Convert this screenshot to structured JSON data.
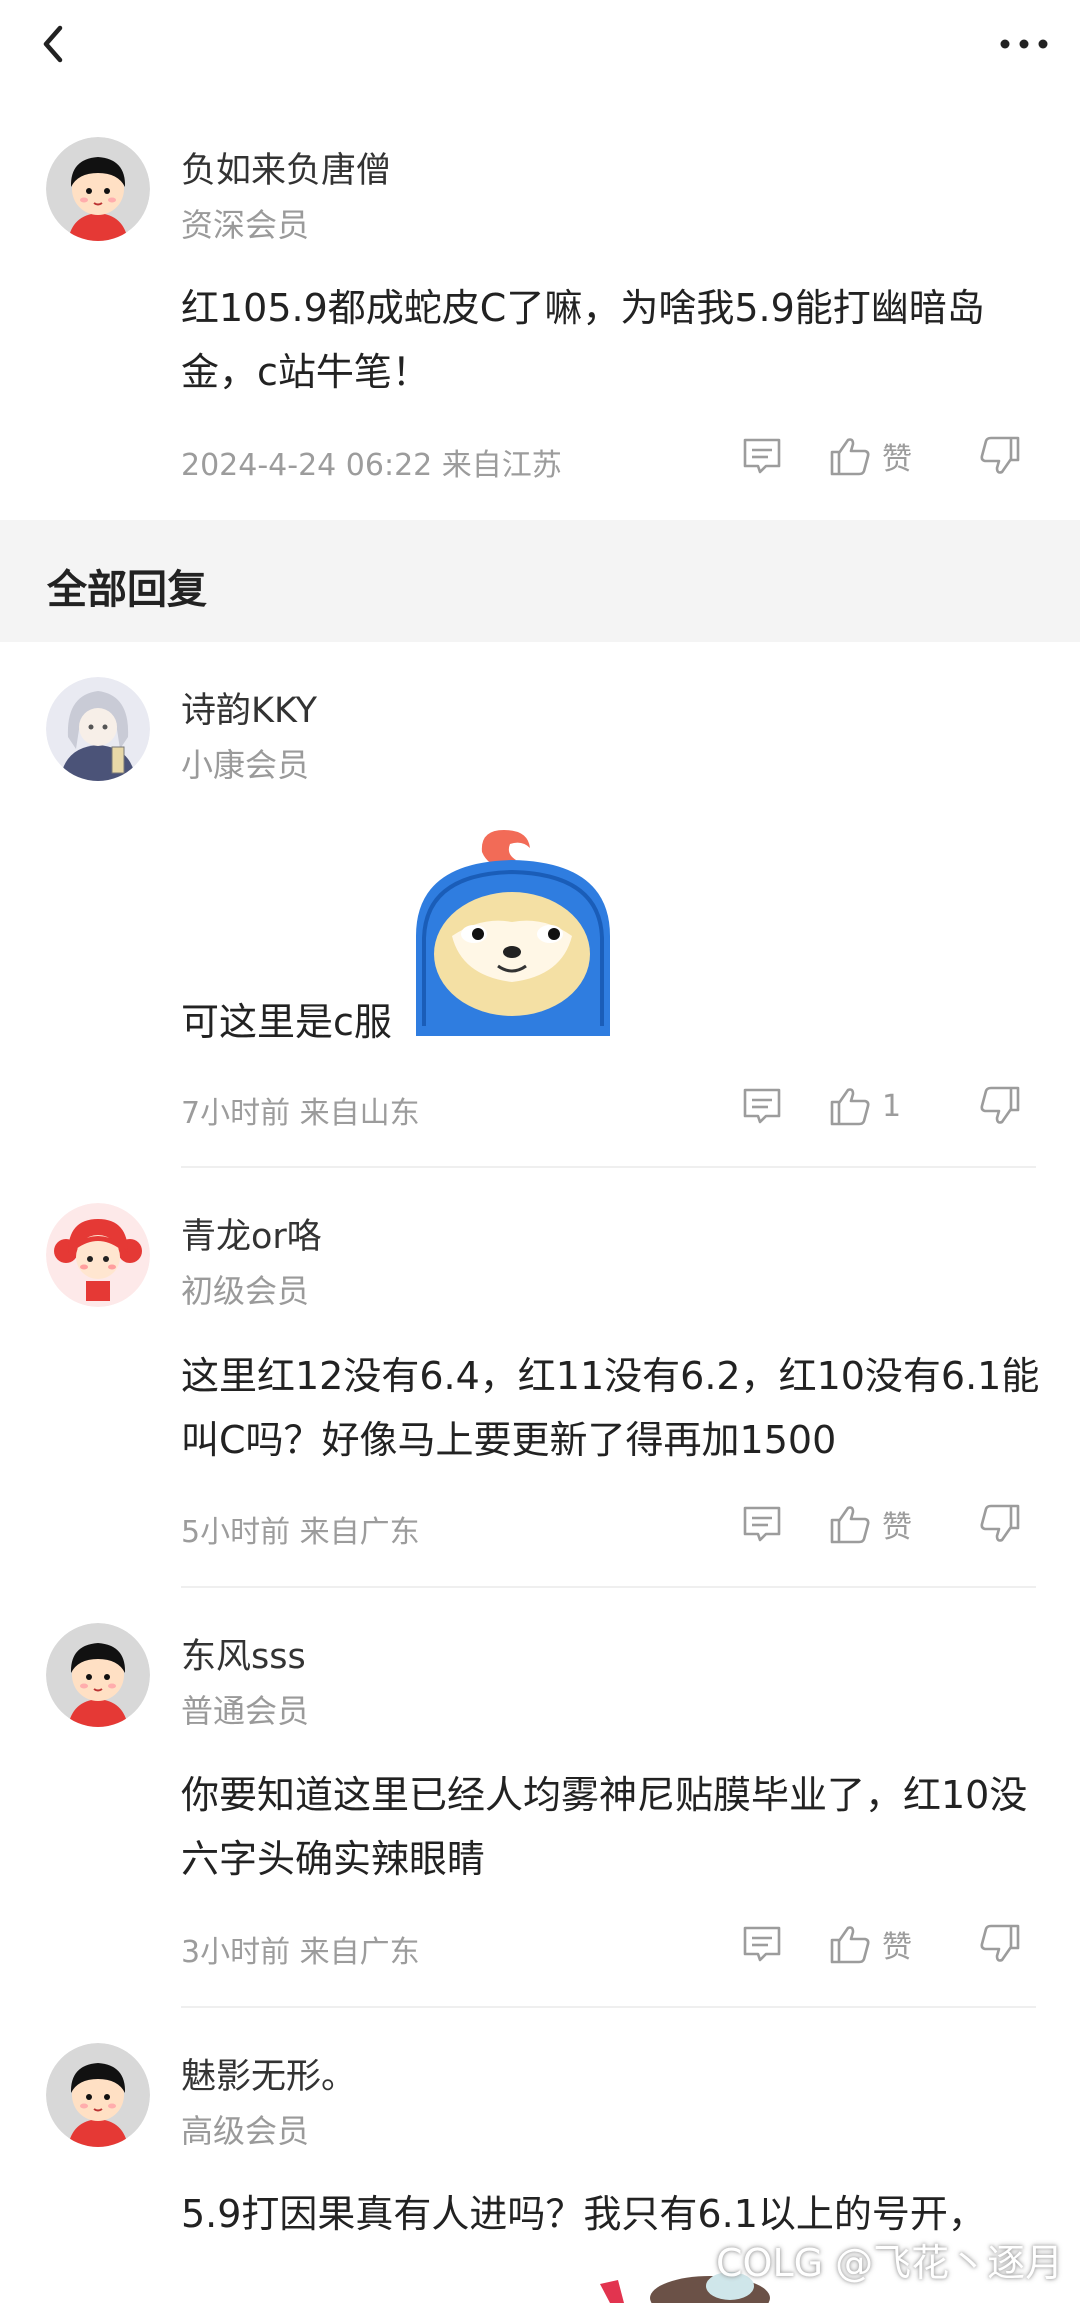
{
  "post": {
    "author": "负如来负唐僧",
    "level": "资深会员",
    "content": "红105.9都成蛇皮C了嘛，为啥我5.9能打幽暗岛金，c站牛笔！",
    "meta": "2024-4-24 06:22  来自江苏",
    "like_label": "赞"
  },
  "section_title": "全部回复",
  "replies": [
    {
      "author": "诗韵KKY",
      "level": "小康会员",
      "content": "可这里是c服",
      "meta": "7小时前 来自山东",
      "like_label": "1",
      "avatar": "anime-avatar"
    },
    {
      "author": "青龙or咯",
      "level": "初级会员",
      "content": "这里红12没有6.4，红11没有6.2，红10没有6.1能叫C吗？好像马上要更新了得再加1500",
      "meta": "5小时前 来自广东",
      "like_label": "赞",
      "avatar": "red-girl-avatar"
    },
    {
      "author": "东风sss",
      "level": "普通会员",
      "content": "你要知道这里已经人均雾神尼贴膜毕业了，红10没六字头确实辣眼睛",
      "meta": "3小时前 来自广东",
      "like_label": "赞",
      "avatar": "default-avatar"
    },
    {
      "author": "魅影无形。",
      "level": "高级会员",
      "content": "5.9打因果真有人进吗？我只有6.1以上的号开，",
      "meta": "",
      "like_label": "",
      "avatar": "default-avatar"
    }
  ],
  "watermark": "COLG @飞花丶逐月",
  "colors": {
    "divider": "#efefef",
    "section_bg": "#f4f4f4",
    "meta": "#9c9c9c"
  }
}
